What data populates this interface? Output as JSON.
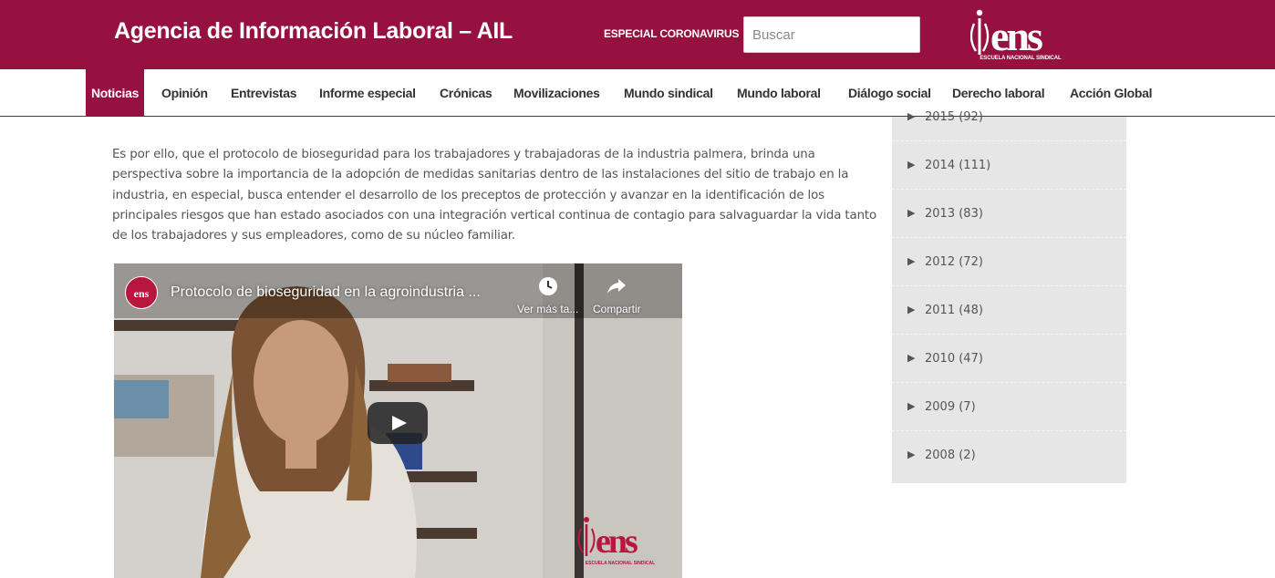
{
  "header": {
    "site_title": "Agencia de Información Laboral – AIL",
    "especial_link": "ESPECIAL CORONAVIRUS",
    "search_placeholder": "Buscar",
    "logo_text": "ens",
    "logo_subtext": "ESCUELA NACIONAL SINDICAL",
    "brand_color": "#96113f"
  },
  "nav": {
    "items": [
      "Noticias",
      "Opinión",
      "Entrevistas",
      "Informe especial",
      "Crónicas",
      "Movilizaciones",
      "Mundo sindical",
      "Mundo laboral",
      "Diálogo social",
      "Derecho laboral",
      "Acción Global"
    ],
    "active": "Noticias"
  },
  "article": {
    "paragraph": "Es por ello, que el protocolo de bioseguridad para los trabajadores y trabajadoras de la industria palmera, brinda una perspectiva sobre la importancia de la adopción de medidas sanitarias dentro de las instalaciones del sitio de trabajo en la industria, en especial, busca entender el desarrollo de los preceptos de protección y avanzar en la identificación de los principales riesgos que han estado asociados con una integración vertical continua de contagio para salvaguardar la vida tanto de los trabajadores y sus empleadores, como de su núcleo familiar."
  },
  "video": {
    "title": "Protocolo de bioseguridad en la agroindustria ...",
    "channel_avatar_text": "ens",
    "watch_later_label": "Ver más ta...",
    "share_label": "Compartir"
  },
  "archive": {
    "partial_row": "2015 (92)",
    "items": [
      {
        "year": "2014",
        "count": "(111)"
      },
      {
        "year": "2013",
        "count": "(83)"
      },
      {
        "year": "2012",
        "count": "(72)"
      },
      {
        "year": "2011",
        "count": "(48)"
      },
      {
        "year": "2010",
        "count": "(47)"
      },
      {
        "year": "2009",
        "count": "(7)"
      },
      {
        "year": "2008",
        "count": "(2)"
      }
    ]
  }
}
